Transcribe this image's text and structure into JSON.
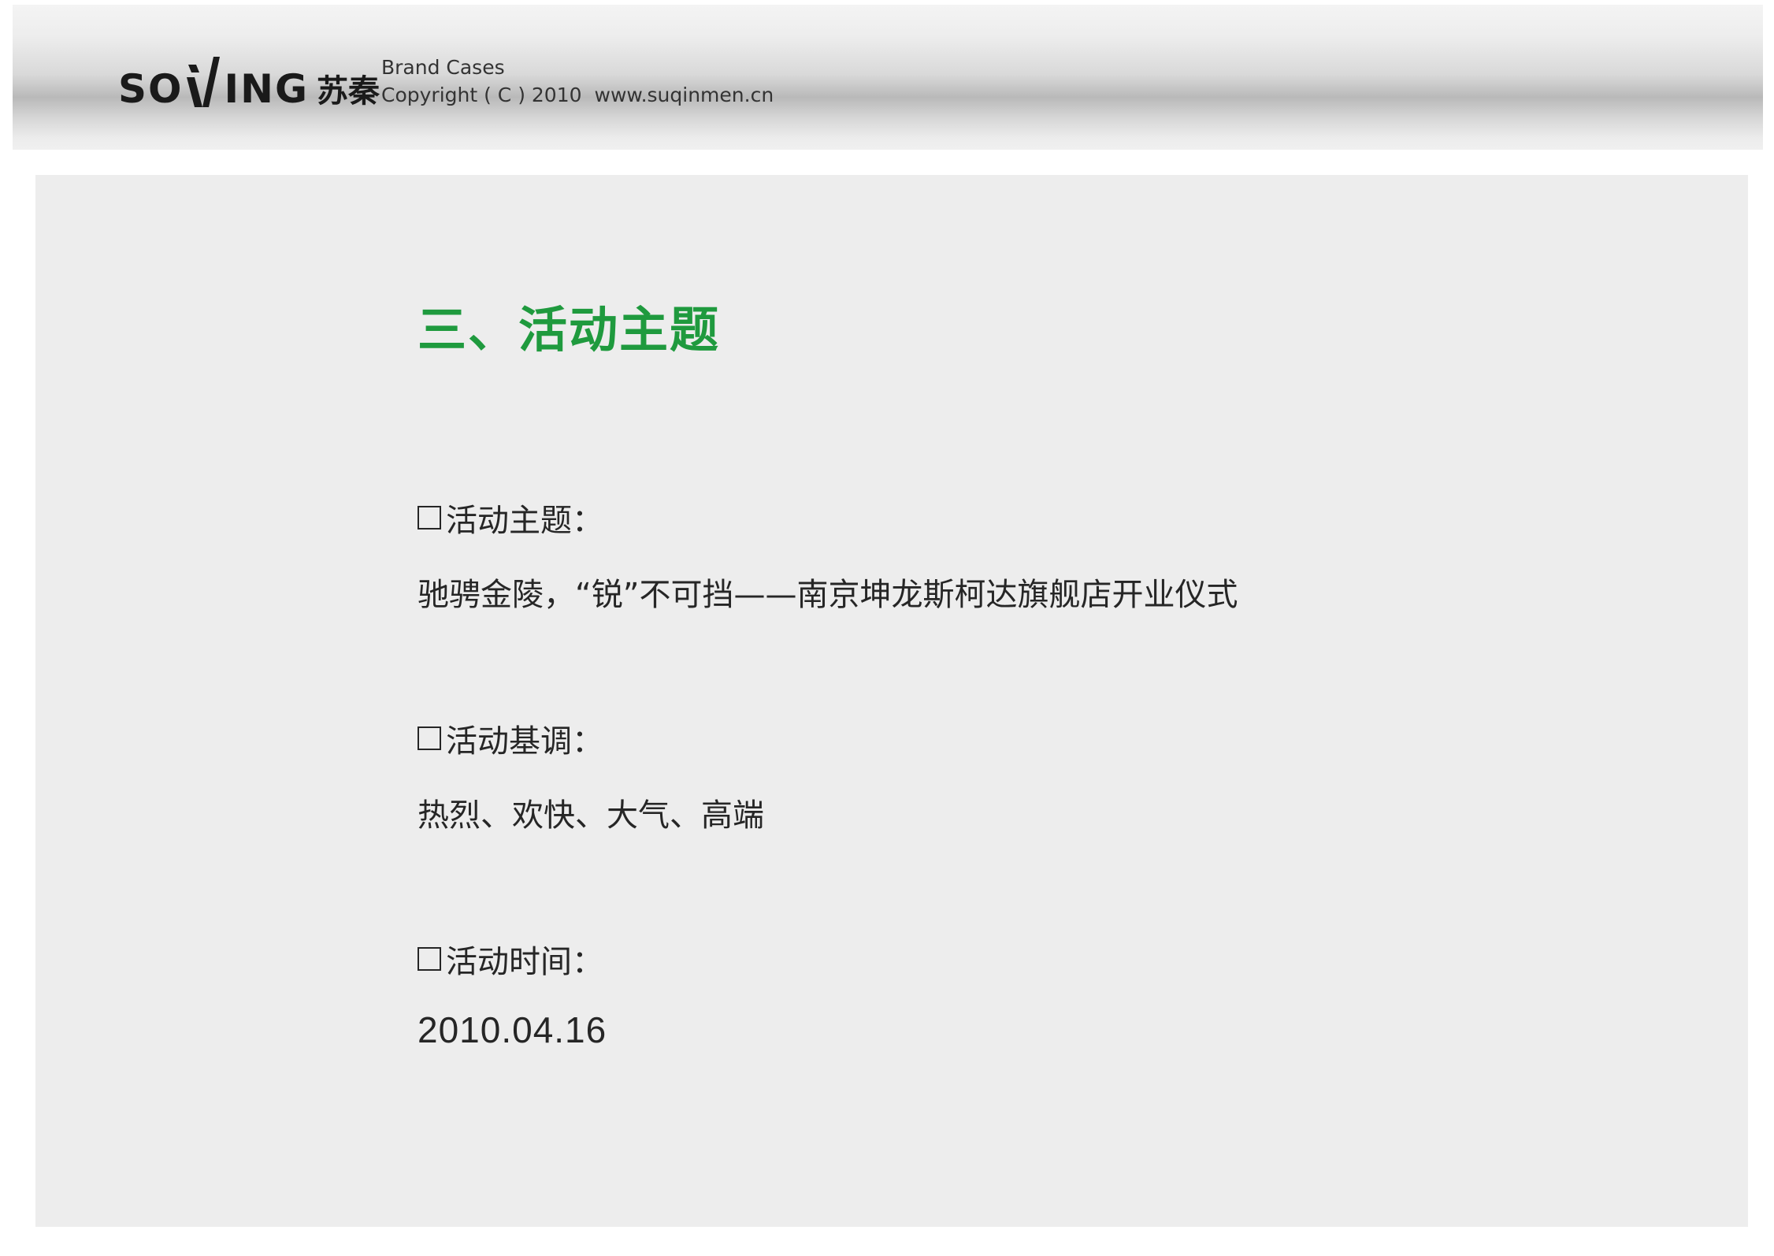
{
  "header": {
    "logo": {
      "latin_left": "SO",
      "latin_right": "ING",
      "chinese": "苏秦",
      "mark_icon": "stylized-x-mark-icon"
    },
    "line1": "Brand Cases",
    "copyright": "Copyright ( C ) 2010",
    "website": "www.suqinmen.cn"
  },
  "content": {
    "section_title": "三、活动主题",
    "items": [
      {
        "label": "活动主题：",
        "value": "驰骋金陵，“锐”不可挡——南京坤龙斯柯达旗舰店开业仪式"
      },
      {
        "label": "活动基调：",
        "value": "热烈、欢快、大气、高端"
      },
      {
        "label": "活动时间：",
        "value": "2010.04.16"
      }
    ]
  },
  "colors": {
    "title_green": "#1f9a3e",
    "panel_background": "#ededed",
    "text_dark": "#262626"
  }
}
